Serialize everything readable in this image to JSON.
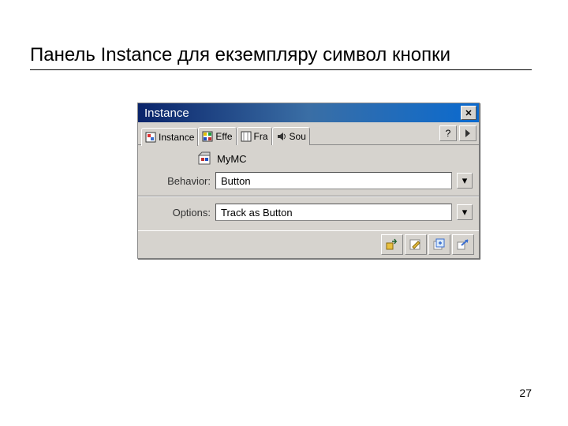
{
  "page": {
    "title": "Панель Instance для екземпляру символ кнопки",
    "number": "27"
  },
  "panel": {
    "title": "Instance",
    "close_glyph": "✕",
    "help_glyph": "?",
    "tabs": [
      {
        "label": "Instance"
      },
      {
        "label": "Effe"
      },
      {
        "label": "Fra"
      },
      {
        "label": "Sou"
      }
    ],
    "symbol_name": "MyMC",
    "fields": {
      "behavior": {
        "label": "Behavior:",
        "value": "Button"
      },
      "options": {
        "label": "Options:",
        "value": "Track as Button"
      }
    },
    "dropdown_glyph": "▾"
  }
}
